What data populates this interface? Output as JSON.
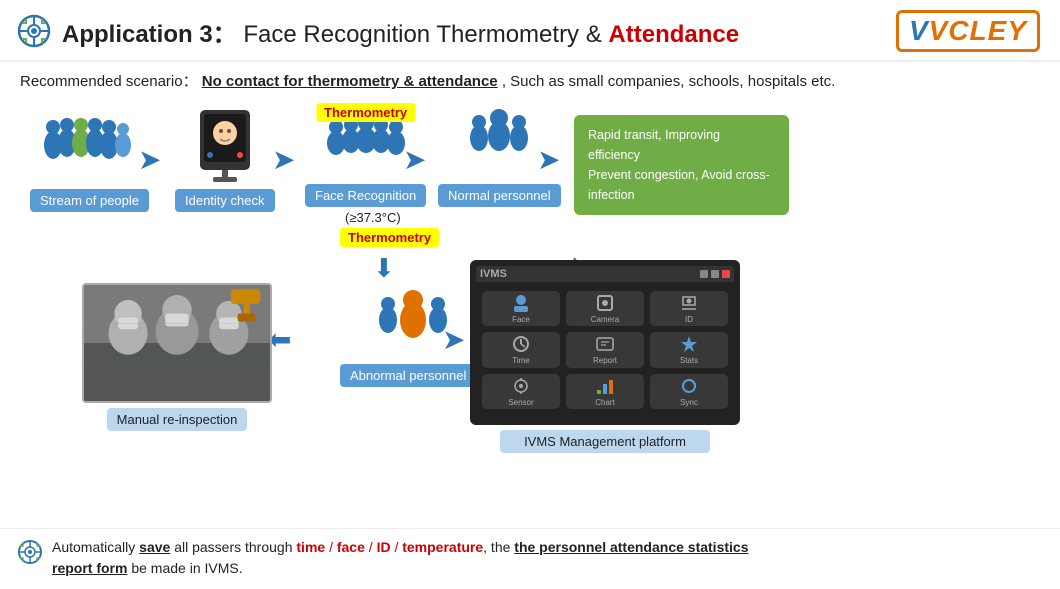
{
  "header": {
    "title_prefix": "Application 3：",
    "title_main": "Face Recognition Thermometry & ",
    "title_red": "Attendance",
    "logo": "VCLEY"
  },
  "scenario": {
    "label": "Recommended scenario：",
    "bold_text": "No contact for thermometry & attendance",
    "rest": ",  Such as small companies, schools, hospitals etc."
  },
  "flow_top": {
    "items": [
      {
        "id": "stream",
        "label": "Stream of people"
      },
      {
        "id": "identity",
        "label": "Identity check"
      },
      {
        "id": "face",
        "label": "Face Recognition"
      },
      {
        "id": "normal",
        "label": "Normal personnel"
      }
    ],
    "thermometry_badge": "Thermometry",
    "green_box_line1": "Rapid transit, Improving efficiency",
    "green_box_line2": "Prevent congestion, Avoid cross-infection"
  },
  "flow_middle": {
    "temp_label": "(≥37.3°C)",
    "therm_label": "Thermometry",
    "abnormal_label": "Abnormal personnel"
  },
  "flow_bottom": {
    "manual_label": "Manual re-inspection",
    "ivms_label": "IVMS Management platform",
    "ivms_title": "IVMS"
  },
  "bottom_text": {
    "prefix": "Automatically ",
    "save": "save",
    "mid1": " all passers through ",
    "time": "time",
    "slash1": " / ",
    "face": "face",
    "slash2": " / ",
    "id": "ID",
    "slash3": " / ",
    "temp": "temperature",
    "comma": ",  the ",
    "stats": "the personnel attendance statistics",
    "report": "report form",
    "suffix": " be made in IVMS."
  },
  "icons": {
    "crosshair": "⊕",
    "arrow_right": "➜",
    "arrow_left": "⬅",
    "arrow_down": "⬇",
    "arrow_diag": "↘"
  }
}
